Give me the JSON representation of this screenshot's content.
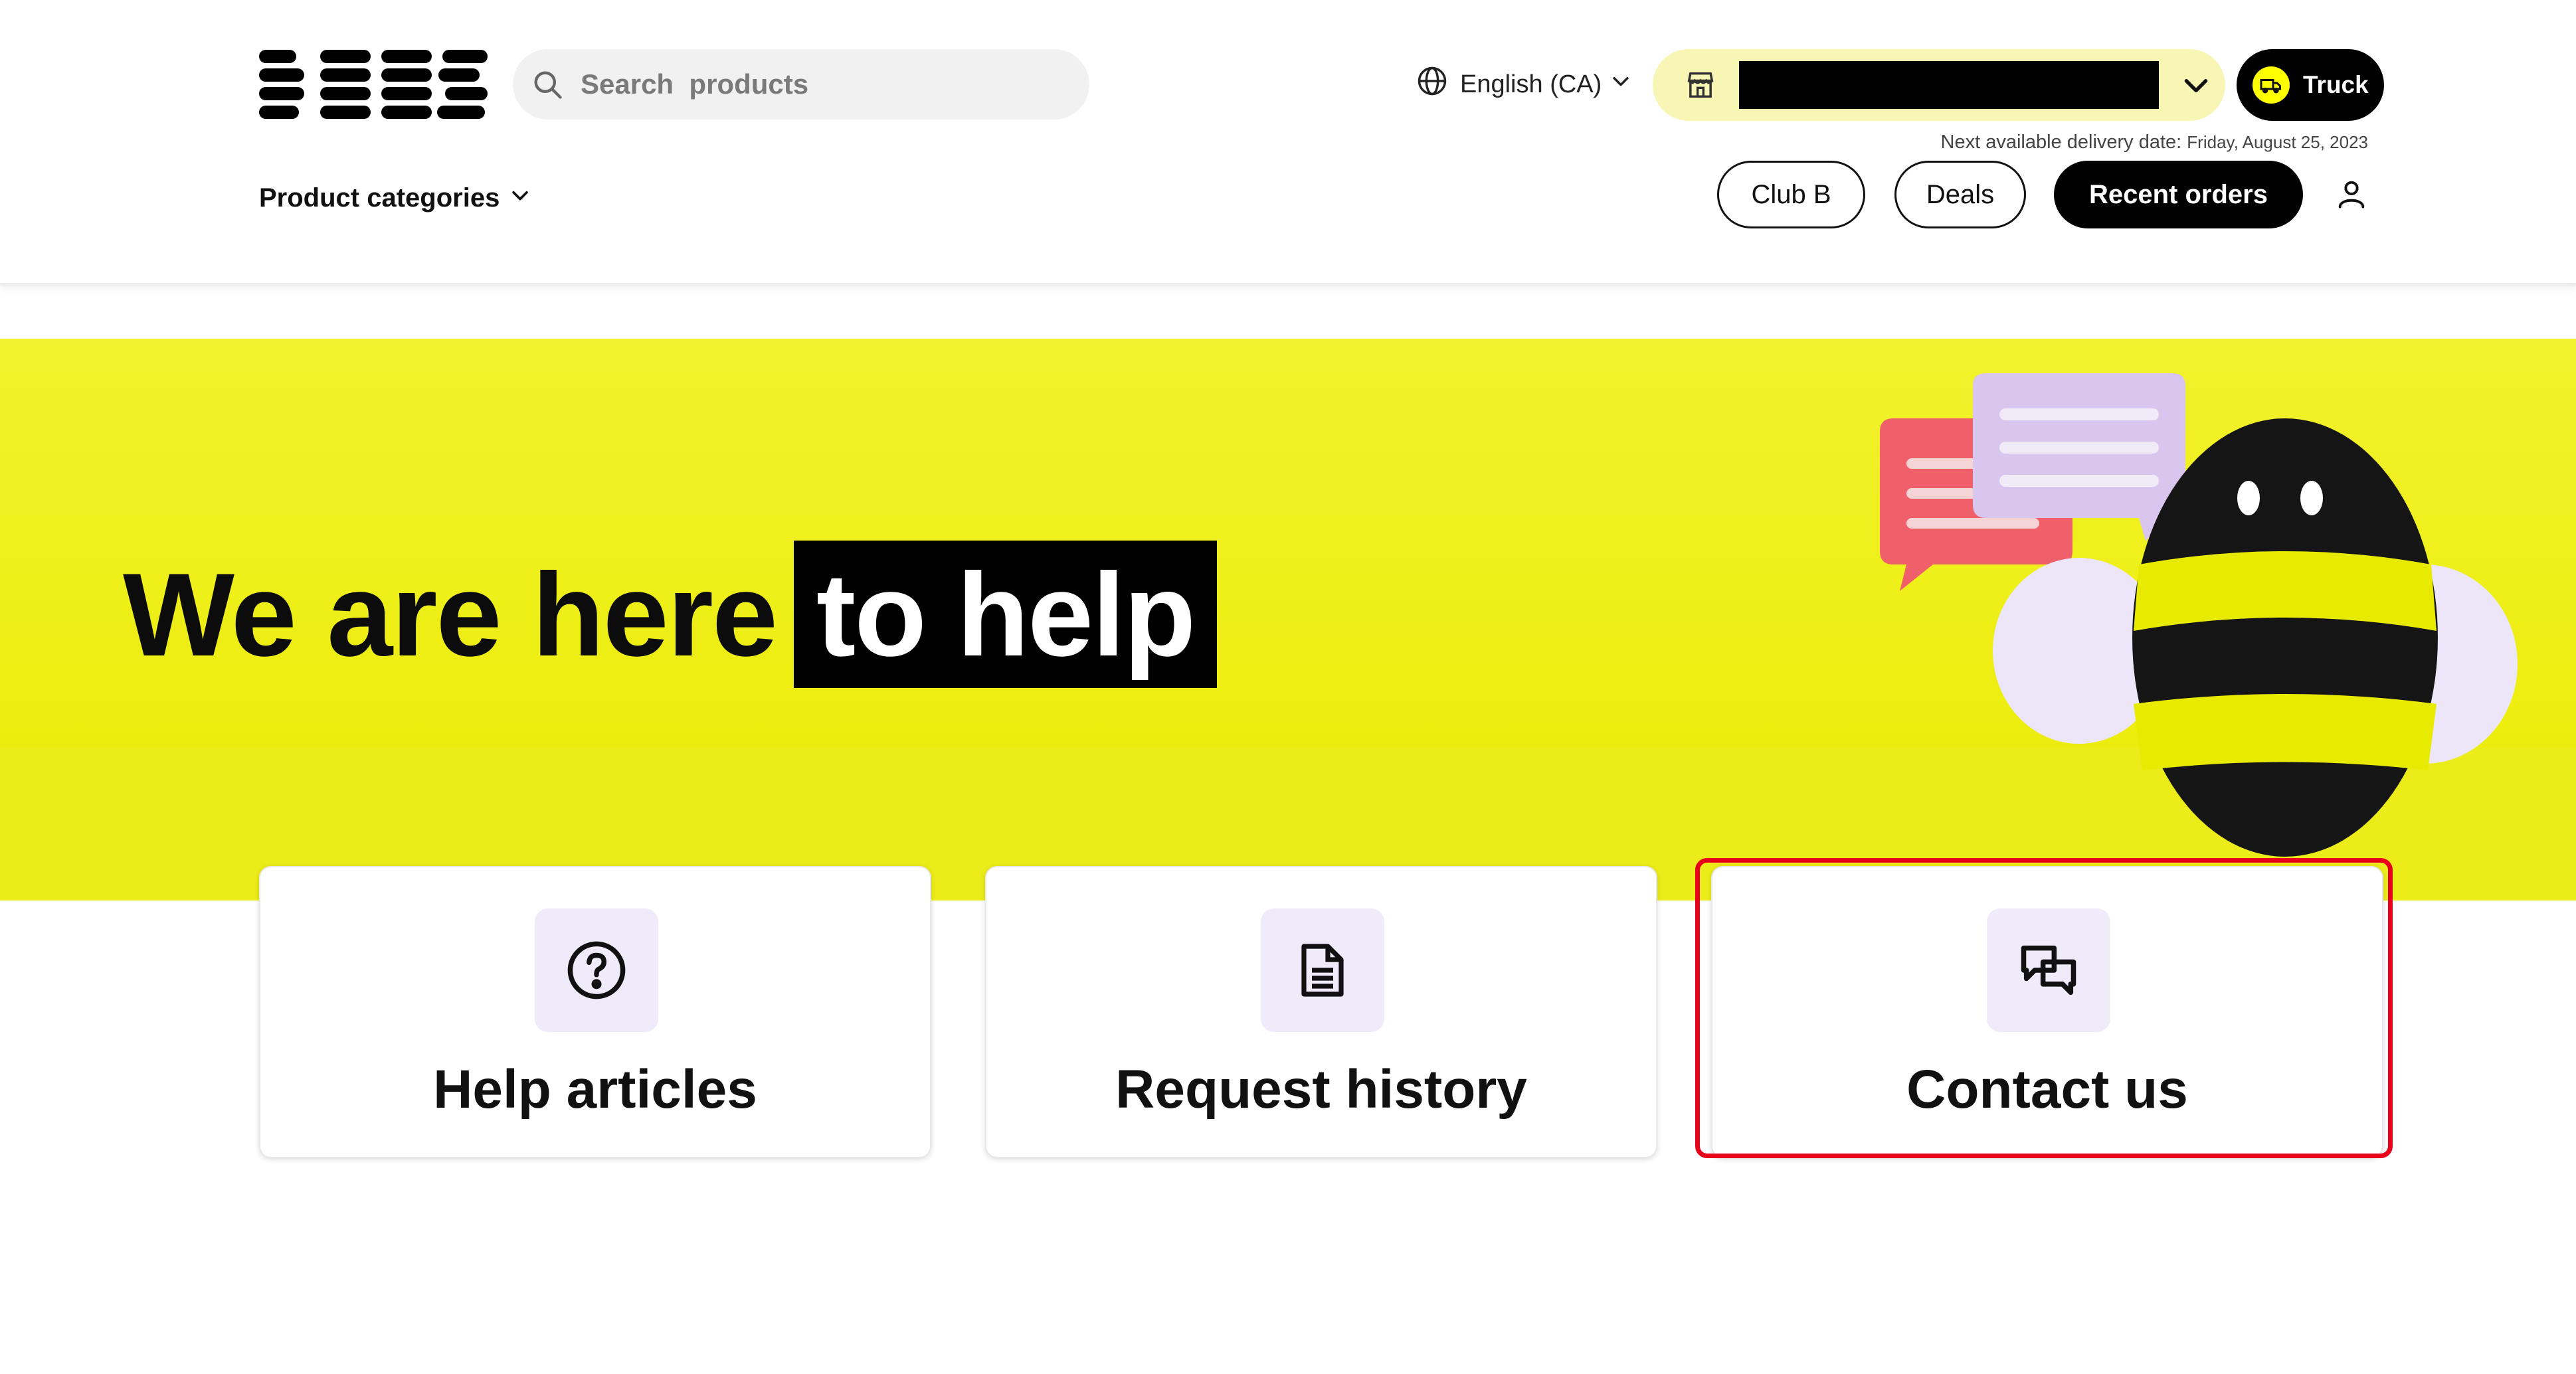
{
  "header": {
    "logo_text": "BEES",
    "logo_icon": "bees-logo",
    "search": {
      "placeholder": "Search  products",
      "value": "",
      "icon": "search-icon"
    },
    "language": {
      "label": "English (CA)",
      "icon": "globe-icon"
    },
    "store_selector": {
      "icon": "store-icon",
      "value": "",
      "redacted": true
    },
    "truck_button": {
      "label": "Truck",
      "icon": "truck-icon",
      "icon_color": "#ffff00"
    },
    "delivery_note": {
      "label": "Next available delivery date:",
      "date": "Friday, August 25, 2023"
    },
    "product_categories": {
      "label": "Product categories"
    },
    "nav": {
      "club_b": "Club B",
      "deals": "Deals",
      "recent_orders": "Recent orders"
    },
    "account_icon": "user-icon"
  },
  "hero": {
    "title_part1": "We are here",
    "title_highlight": "to help",
    "background_color": "#eeee10",
    "illustration": "bee-chat-illustration"
  },
  "cards": [
    {
      "title": "Help articles",
      "icon": "question-circle-icon"
    },
    {
      "title": "Request history",
      "icon": "document-icon"
    },
    {
      "title": "Contact us",
      "icon": "chat-bubbles-icon",
      "highlighted": true
    }
  ],
  "colors": {
    "brand_yellow": "#eeee10",
    "black": "#000000",
    "card_icon_bg": "#efebfb",
    "highlight_red": "#e8001a"
  }
}
